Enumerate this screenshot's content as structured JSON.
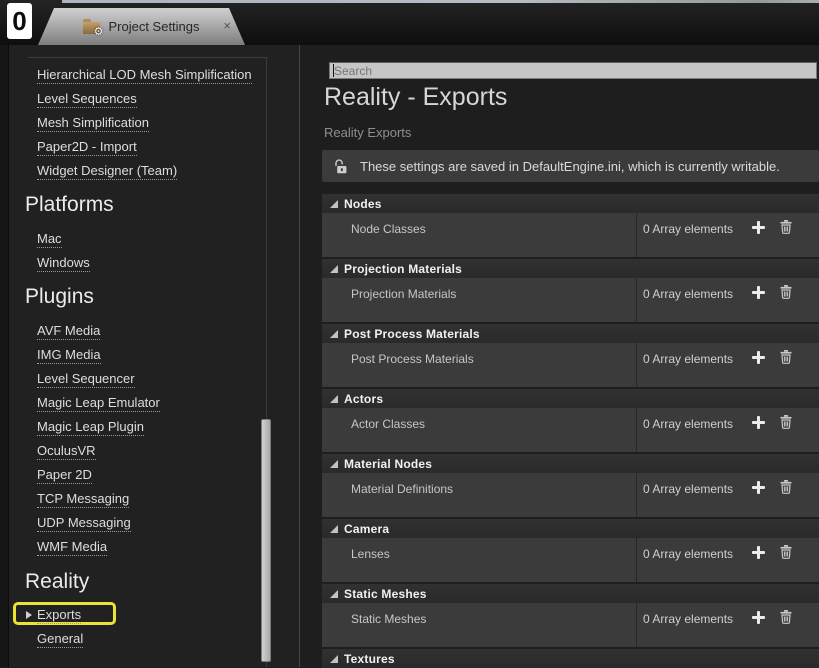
{
  "window": {
    "app_icon_glyph": "0",
    "tab": {
      "title": "Project Settings",
      "close_label": "×"
    }
  },
  "sidebar": {
    "loose_items": [
      "Hierarchical LOD Mesh Simplification",
      "Level Sequences",
      "Mesh Simplification",
      "Paper2D - Import",
      "Widget Designer (Team)"
    ],
    "sections": [
      {
        "title": "Platforms",
        "items": [
          "Mac",
          "Windows"
        ]
      },
      {
        "title": "Plugins",
        "items": [
          "AVF Media",
          "IMG Media",
          "Level Sequencer",
          "Magic Leap Emulator",
          "Magic Leap Plugin",
          "OculusVR",
          "Paper 2D",
          "TCP Messaging",
          "UDP Messaging",
          "WMF Media"
        ]
      },
      {
        "title": "Reality",
        "items": [
          "Exports",
          "General"
        ],
        "selected_item": "Exports"
      }
    ]
  },
  "main": {
    "search_placeholder": "Search",
    "title": "Reality - Exports",
    "subtitle": "Reality Exports",
    "notice": "These settings are saved in DefaultEngine.ini, which is currently writable.",
    "sections": [
      {
        "title": "Nodes",
        "row_label": "Node Classes",
        "row_value": "0 Array elements"
      },
      {
        "title": "Projection Materials",
        "row_label": "Projection Materials",
        "row_value": "0 Array elements"
      },
      {
        "title": "Post Process Materials",
        "row_label": "Post Process Materials",
        "row_value": "0 Array elements"
      },
      {
        "title": "Actors",
        "row_label": "Actor Classes",
        "row_value": "0 Array elements"
      },
      {
        "title": "Material Nodes",
        "row_label": "Material Definitions",
        "row_value": "0 Array elements"
      },
      {
        "title": "Camera",
        "row_label": "Lenses",
        "row_value": "0 Array elements"
      },
      {
        "title": "Static Meshes",
        "row_label": "Static Meshes",
        "row_value": "0 Array elements"
      },
      {
        "title": "Textures"
      }
    ]
  },
  "colors": {
    "highlight_box": "#e9e331",
    "row_bg": "#3b3b3b",
    "header_bg": "#2e2e2e"
  }
}
